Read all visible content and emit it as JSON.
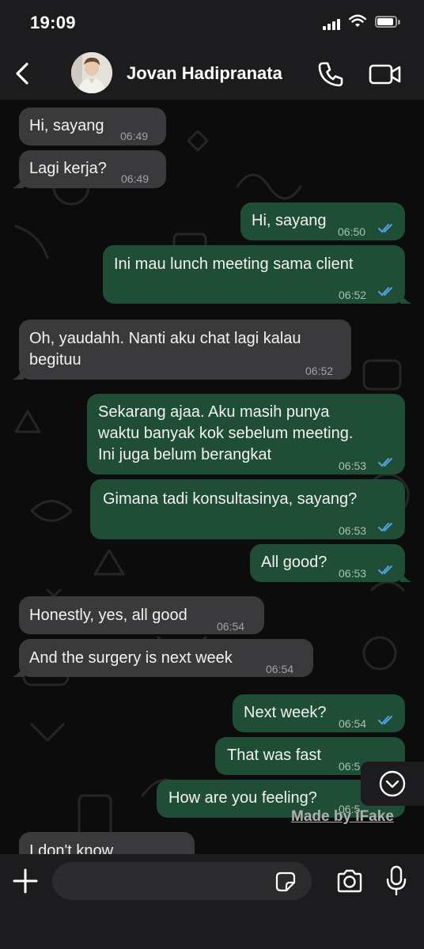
{
  "status_bar": {
    "time": "19:09"
  },
  "header": {
    "contact_name": "Jovan Hadipranata"
  },
  "messages": [
    {
      "direction": "in",
      "text": "Hi, sayang",
      "time": "06:49"
    },
    {
      "direction": "in",
      "text": "Lagi kerja?",
      "time": "06:49"
    },
    {
      "direction": "out",
      "text": "Hi, sayang",
      "time": "06:50"
    },
    {
      "direction": "out",
      "text": "Ini mau lunch meeting sama client",
      "time": "06:52"
    },
    {
      "direction": "in",
      "text": "Oh, yaudahh. Nanti aku chat lagi kalau\nbegituu",
      "time": "06:52"
    },
    {
      "direction": "out",
      "text": "Sekarang ajaa. Aku masih punya\nwaktu banyak kok sebelum meeting.\nIni juga belum berangkat",
      "time": "06:53"
    },
    {
      "direction": "out",
      "text": "Gimana tadi konsultasinya, sayang?",
      "time": "06:53"
    },
    {
      "direction": "out",
      "text": "All good?",
      "time": "06:53"
    },
    {
      "direction": "in",
      "text": "Honestly, yes, all good",
      "time": "06:54"
    },
    {
      "direction": "in",
      "text": "And the surgery is next week",
      "time": "06:54"
    },
    {
      "direction": "out",
      "text": "Next week?",
      "time": "06:54"
    },
    {
      "direction": "out",
      "text": "That was fast",
      "time": "06:5"
    },
    {
      "direction": "out",
      "text": "How are you feeling?",
      "time": "06:5"
    },
    {
      "direction": "in",
      "text": "I don't know",
      "time": ""
    }
  ],
  "watermark": "Made by iFake",
  "input": {
    "placeholder": ""
  },
  "colors": {
    "incoming_bubble": "#3a3a3c",
    "outgoing_bubble": "#1f4d35",
    "read_ticks": "#4fa3e0",
    "header_bg": "#1c1c1e"
  },
  "icons": [
    "back-chevron-icon",
    "phone-icon",
    "video-camera-icon",
    "plus-icon",
    "sticker-icon",
    "camera-icon",
    "microphone-icon",
    "chevron-down-icon",
    "read-ticks-icon"
  ]
}
